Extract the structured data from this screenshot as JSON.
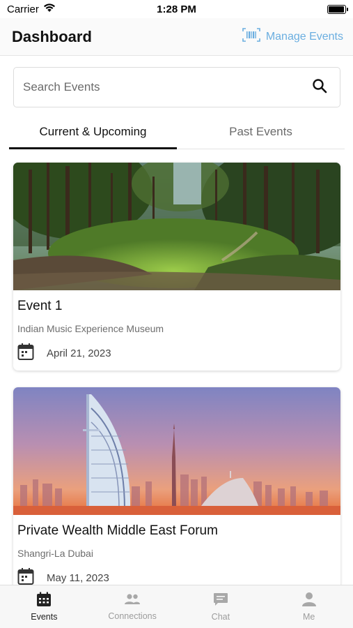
{
  "status_bar": {
    "carrier": "Carrier",
    "time": "1:28 PM",
    "battery_level": 0.95
  },
  "header": {
    "title": "Dashboard",
    "manage_label": "Manage Events",
    "accent_color": "#6aaee0"
  },
  "search": {
    "placeholder": "Search Events",
    "value": ""
  },
  "tabs": [
    {
      "label": "Current & Upcoming",
      "active": true
    },
    {
      "label": "Past Events",
      "active": false
    }
  ],
  "events": [
    {
      "title": "Event 1",
      "venue": "Indian Music Experience Museum",
      "date": "April 21, 2023",
      "image": "forest-clearing-photo",
      "icon": "calendar-icon"
    },
    {
      "title": "Private Wealth Middle East Forum",
      "venue": "Shangri-La Dubai",
      "date": "May 11, 2023",
      "image": "dubai-skyline-photo",
      "icon": "calendar-icon"
    }
  ],
  "bottom_nav": [
    {
      "label": "Events",
      "icon": "calendar-icon",
      "active": true
    },
    {
      "label": "Connections",
      "icon": "people-icon",
      "active": false
    },
    {
      "label": "Chat",
      "icon": "chat-bubble-icon",
      "active": false
    },
    {
      "label": "Me",
      "icon": "person-icon",
      "active": false
    }
  ]
}
